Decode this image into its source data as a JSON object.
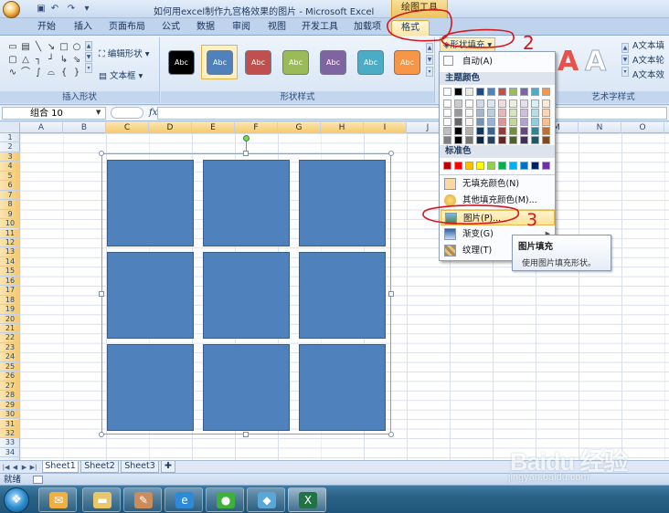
{
  "window": {
    "title": "如何用excel制作九宫格效果的图片 - Microsoft Excel",
    "context_tool": "绘图工具"
  },
  "tabs": [
    "开始",
    "插入",
    "页面布局",
    "公式",
    "数据",
    "审阅",
    "视图",
    "开发工具",
    "加载项",
    "格式"
  ],
  "ribbon": {
    "insert_shapes": {
      "edit_shape": "编辑形状",
      "text_box": "文本框",
      "label": "插入形状"
    },
    "shape_styles": {
      "tiles": [
        {
          "text": "Abc",
          "color": "#000000"
        },
        {
          "text": "Abc",
          "color": "#4f81bd"
        },
        {
          "text": "Abc",
          "color": "#c0504d"
        },
        {
          "text": "Abc",
          "color": "#9bbb59"
        },
        {
          "text": "Abc",
          "color": "#8064a2"
        },
        {
          "text": "Abc",
          "color": "#4bacc6"
        },
        {
          "text": "Abc",
          "color": "#f79646"
        }
      ],
      "label": "形状样式"
    },
    "shape_fill": "形状填充",
    "wordart": {
      "label": "艺术字样式",
      "text_fill": "文本填",
      "text_outline": "文本轮",
      "text_effect": "文本效"
    }
  },
  "formula_bar": {
    "name_box": "组合 10",
    "fx": "fx",
    "value": ""
  },
  "columns": [
    "A",
    "B",
    "C",
    "D",
    "E",
    "F",
    "G",
    "H",
    "I",
    "J",
    "K",
    "L",
    "M",
    "N",
    "O"
  ],
  "rows": [
    "1",
    "2",
    "3",
    "4",
    "5",
    "6",
    "7",
    "8",
    "9",
    "10",
    "11",
    "12",
    "13",
    "14",
    "15",
    "16",
    "17",
    "18",
    "19",
    "20",
    "21",
    "22",
    "23",
    "24",
    "25",
    "26",
    "27",
    "28",
    "29",
    "30",
    "31",
    "32",
    "33",
    "34"
  ],
  "fill_menu": {
    "automatic": "自动(A)",
    "theme_colors_heading": "主题颜色",
    "theme_colors": [
      "#ffffff",
      "#000000",
      "#eeece1",
      "#1f497d",
      "#4f81bd",
      "#c0504d",
      "#9bbb59",
      "#8064a2",
      "#4bacc6",
      "#f79646"
    ],
    "standard_colors_heading": "标准色",
    "standard_colors": [
      "#c00000",
      "#ff0000",
      "#ffc000",
      "#ffff00",
      "#92d050",
      "#00b050",
      "#00b0f0",
      "#0070c0",
      "#002060",
      "#7030a0"
    ],
    "items": [
      {
        "label": "无填充颜色(N)",
        "icon": "no-fill-icon"
      },
      {
        "label": "其他填充颜色(M)...",
        "icon": "palette-icon"
      },
      {
        "label": "图片(P)...",
        "icon": "picture-icon"
      },
      {
        "label": "渐变(G)",
        "icon": "gradient-icon"
      },
      {
        "label": "纹理(T)",
        "icon": "texture-icon"
      }
    ]
  },
  "tooltip": {
    "title": "图片填充",
    "body": "使用图片填充形状。"
  },
  "sheets": [
    "Sheet1",
    "Sheet2",
    "Sheet3"
  ],
  "status": "就绪",
  "annotations": [
    "2",
    "3"
  ],
  "watermark": {
    "logo": "Baidu 经验",
    "url": "jingyan.baidu.com"
  }
}
